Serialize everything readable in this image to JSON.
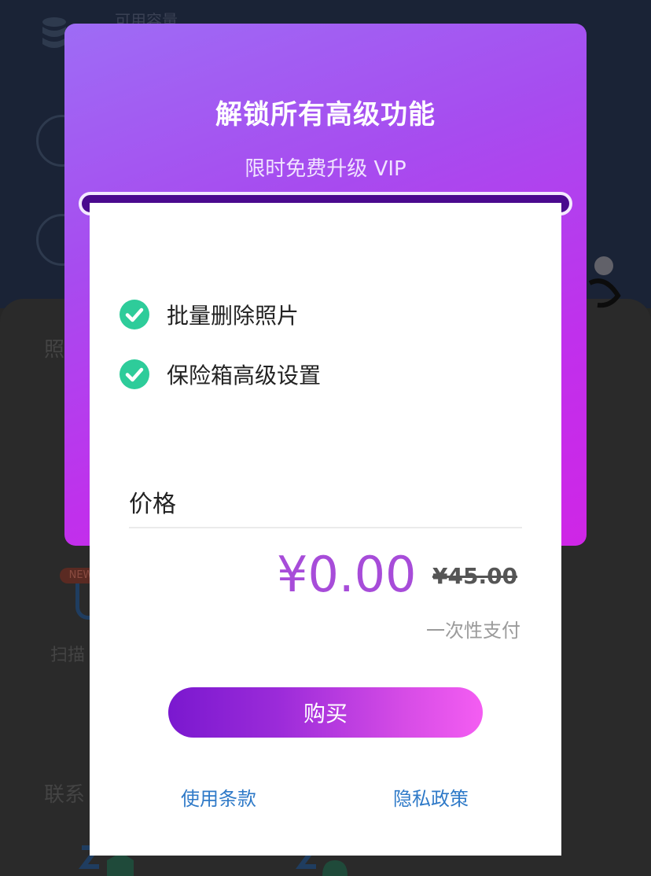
{
  "background": {
    "capacity_label": "可用容量",
    "photos_heading": "照",
    "scan_label": "扫描",
    "contact_heading": "联系",
    "new_badge": "NEW"
  },
  "modal": {
    "title": "解锁所有高级功能",
    "subtitle": "限时免费升级 VIP",
    "features": [
      {
        "label": "批量删除照片",
        "icon": "check-circle-icon"
      },
      {
        "label": "保险箱高级设置",
        "icon": "check-circle-icon"
      }
    ],
    "price": {
      "label": "价格",
      "current": "¥0.00",
      "original": "¥45.00",
      "note": "一次性支付"
    },
    "buy_label": "购买",
    "links": {
      "terms": "使用条款",
      "privacy": "隐私政策"
    }
  },
  "colors": {
    "accent_purple": "#a74cd9",
    "check_green": "#2ecc9a",
    "link_blue": "#2f7ac8",
    "header_gradient_start": "#9e6cf5",
    "header_gradient_end": "#cf26e6"
  }
}
